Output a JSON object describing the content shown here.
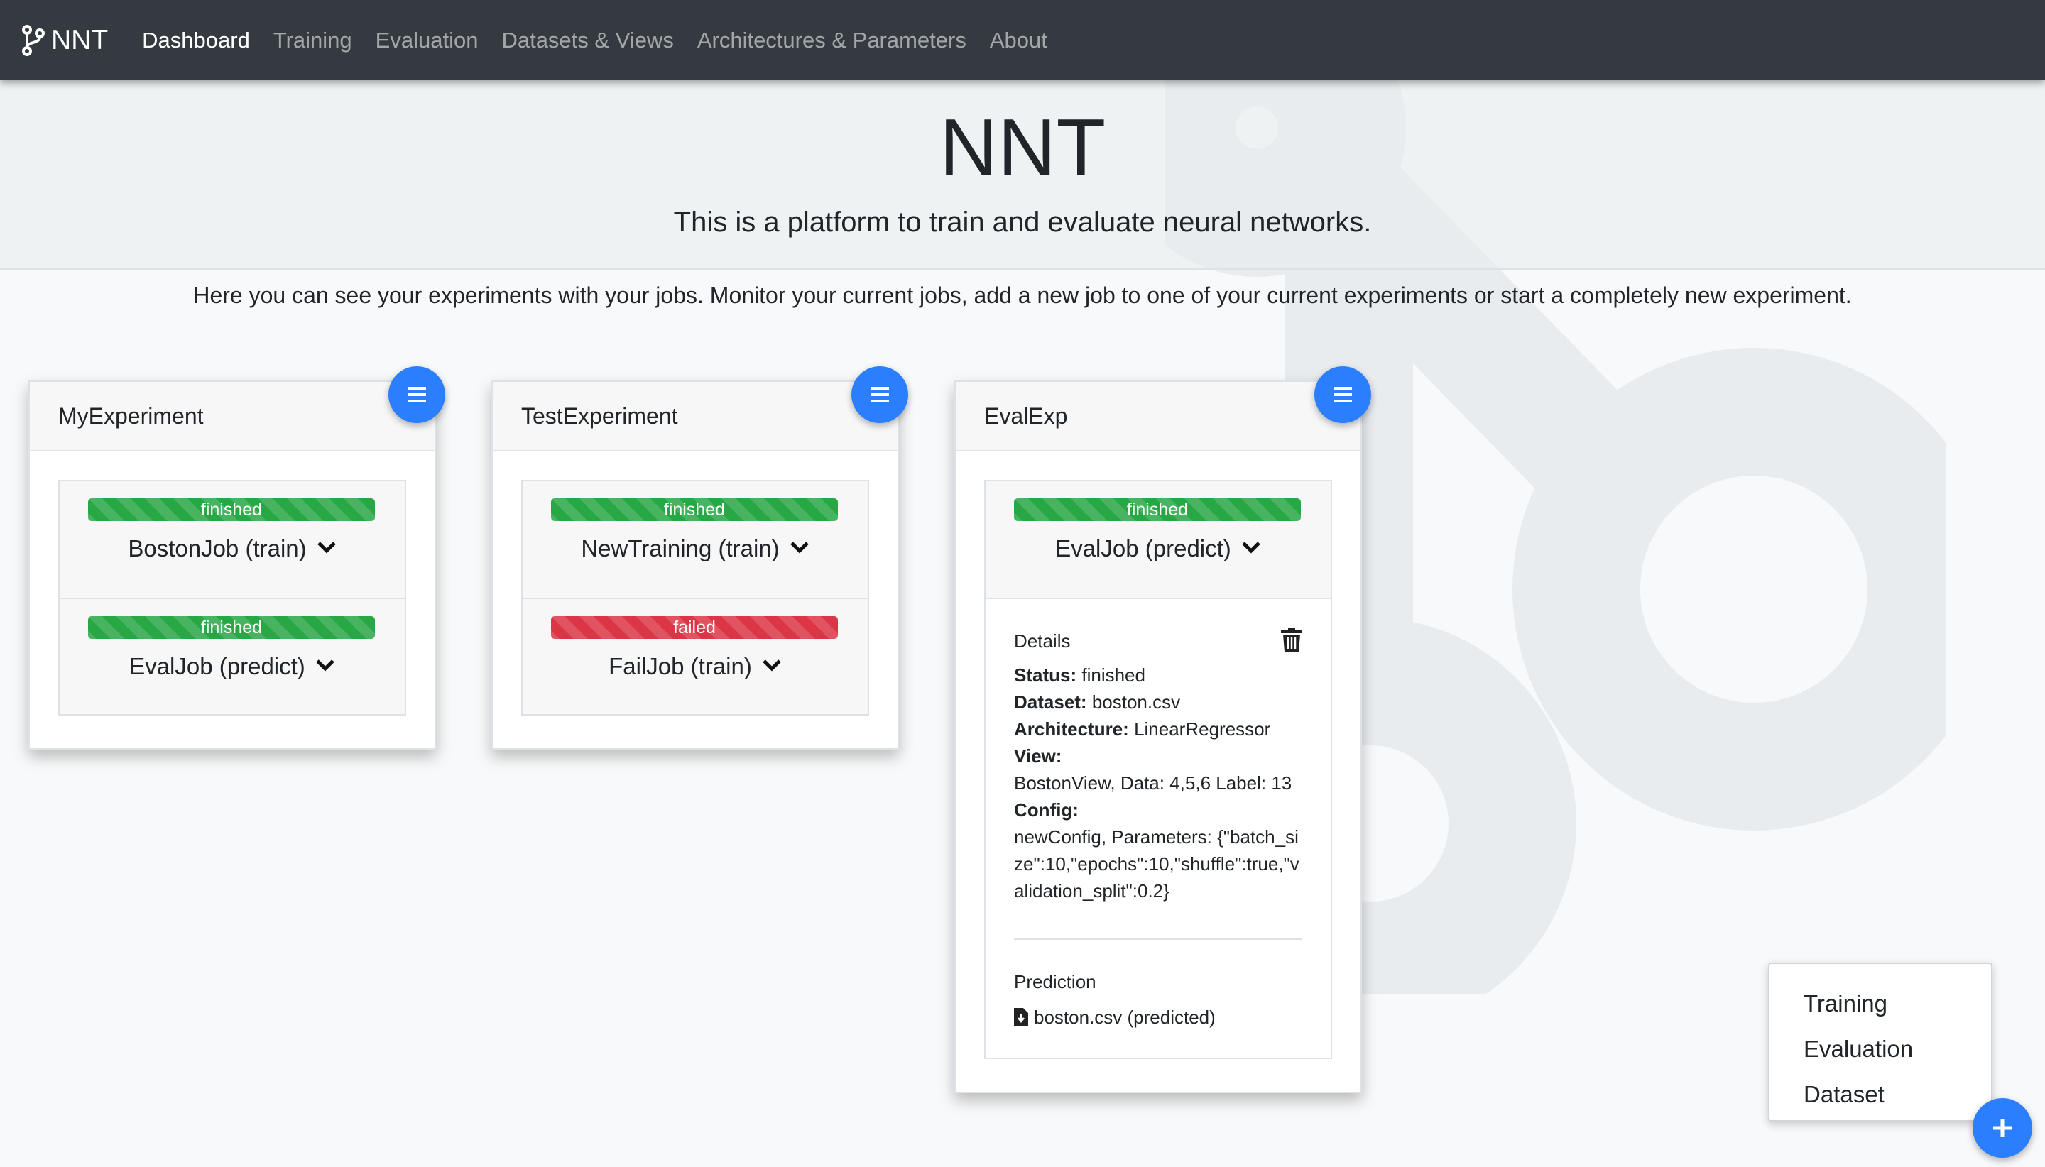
{
  "app": {
    "brand": "NNT",
    "nav": [
      "Dashboard",
      "Training",
      "Evaluation",
      "Datasets & Views",
      "Architectures & Parameters",
      "About"
    ],
    "active_nav": "Dashboard"
  },
  "header": {
    "title": "NNT",
    "lead": "This is a platform to train and evaluate neural networks.",
    "intro": "Here you can see your experiments with your jobs. Monitor your current jobs, add a new job to one of your current experiments or start a completely new experiment."
  },
  "experiments": [
    {
      "name": "MyExperiment",
      "jobs": [
        {
          "status": "finished",
          "title": "BostonJob (train)"
        },
        {
          "status": "finished",
          "title": "EvalJob (predict)"
        }
      ]
    },
    {
      "name": "TestExperiment",
      "jobs": [
        {
          "status": "finished",
          "title": "NewTraining (train)"
        },
        {
          "status": "failed",
          "title": "FailJob (train)"
        }
      ]
    },
    {
      "name": "EvalExp",
      "jobs": [
        {
          "status": "finished",
          "title": "EvalJob (predict)"
        }
      ],
      "details": {
        "heading": "Details",
        "status_label": "Status:",
        "status_value": "finished",
        "dataset_label": "Dataset:",
        "dataset_value": "boston.csv",
        "architecture_label": "Architecture:",
        "architecture_value": "LinearRegressor",
        "view_label": "View:",
        "view_value": "BostonView, Data: 4,5,6 Label: 13",
        "config_label": "Config:",
        "config_value": "newConfig, Parameters: {\"batch_size\":10,\"epochs\":10,\"shuffle\":true,\"validation_split\":0.2}",
        "prediction_heading": "Prediction",
        "prediction_file": "boston.csv (predicted)"
      }
    }
  ],
  "add_menu": {
    "items": [
      "Training",
      "Evaluation",
      "Dataset"
    ]
  },
  "colors": {
    "navbar": "#343a40",
    "accent": "#2b7fff",
    "finished": "#28a745",
    "failed": "#dc3545"
  },
  "icons": {
    "brand": "git-branch-icon",
    "card_menu": "hamburger-menu-icon",
    "expand": "chevron-down-icon",
    "delete": "trash-icon",
    "file": "file-download-icon",
    "add": "plus-icon"
  }
}
